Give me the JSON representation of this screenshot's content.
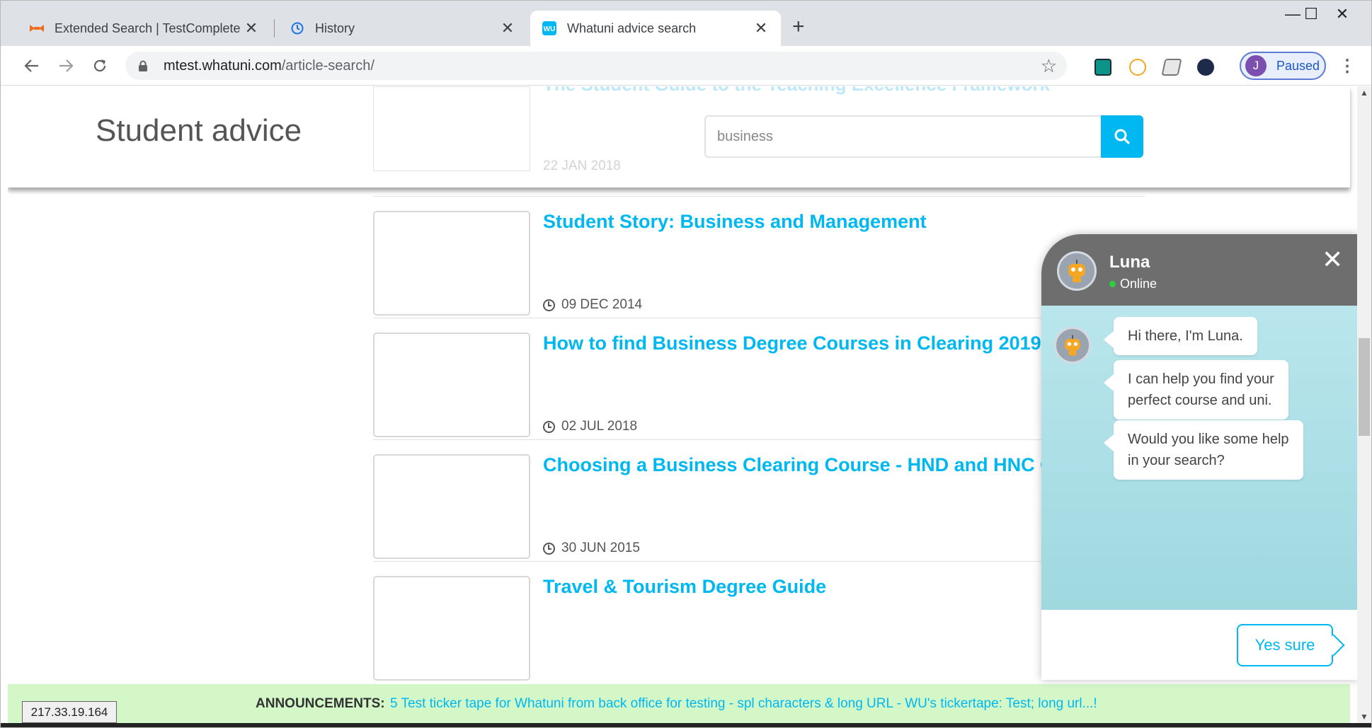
{
  "browser": {
    "tabs": [
      {
        "title": "Extended Search | TestComplete D",
        "favicon": "testcomplete-icon"
      },
      {
        "title": "History",
        "favicon": "history-icon"
      },
      {
        "title": "Whatuni advice search",
        "favicon": "whatuni-icon",
        "active": true
      }
    ],
    "new_tab": "+",
    "url_host": "mtest.whatuni.com",
    "url_path": "/article-search/",
    "profile_initial": "J",
    "profile_label": "Paused",
    "window_controls": {
      "minimize": "—",
      "maximize": "☐",
      "close": "✕"
    }
  },
  "header": {
    "page_title": "Student advice",
    "search_value": "business",
    "ghost_article": {
      "title": "The Student Guide to the Teaching Excellence Framework",
      "date": "22 JAN 2018"
    }
  },
  "articles": [
    {
      "title": "Student Story: Business and Management",
      "date": "09 DEC 2014"
    },
    {
      "title": "How to find Business Degree Courses in Clearing 2019",
      "date": "02 JUL 2018"
    },
    {
      "title": "Choosing a Business Clearing Course - HND and HNC Courses",
      "date": "30 JUN 2015"
    },
    {
      "title": "Travel & Tourism Degree Guide",
      "date": ""
    }
  ],
  "announcement": {
    "label": "ANNOUNCEMENTS:",
    "text": "5 Test ticker tape for Whatuni from back office for testing - spl characters & long URL - WU's tickertape: Test; long url...!"
  },
  "ip_address": "217.33.19.164",
  "chat": {
    "name": "Luna",
    "status": "Online",
    "messages": [
      {
        "line1": "Hi there, I'm Luna.",
        "line2": ""
      },
      {
        "line1": "I can help you find your",
        "line2": "perfect course and uni."
      },
      {
        "line1": "Would you like some help",
        "line2": "in your search?"
      }
    ],
    "reply_button": "Yes sure"
  },
  "colors": {
    "accent": "#00b8f1",
    "announce_bg": "#d4f7c8",
    "chat_header": "#6e6e6e"
  }
}
